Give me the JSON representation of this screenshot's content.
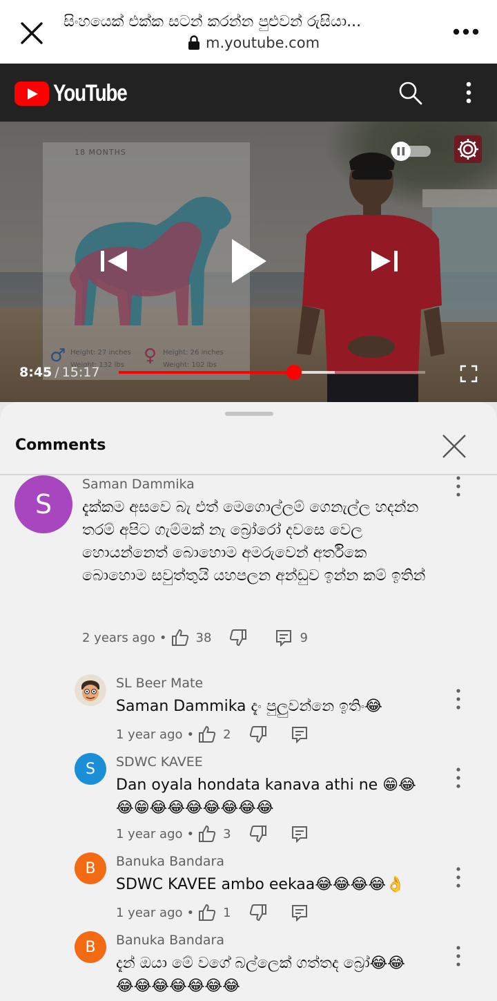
{
  "browser": {
    "title": "සිංහයෙක් එක්ක සටන් කරන්න පුළුවන් රුසියා...",
    "url": "m.youtube.com"
  },
  "header": {
    "logo_text": "YouTube"
  },
  "video": {
    "card_label": "18 MONTHS",
    "male_height": "Height: 27 inches",
    "male_weight": "Weight: 132 lbs",
    "female_height": "Height: 26 inches",
    "female_weight": "Weight: 102 lbs",
    "current_time": "8:45",
    "separator": "/",
    "duration": "15:17",
    "played_fraction": 0.572,
    "buffered_fraction": 0.705,
    "autoplay": "off"
  },
  "comments_panel": {
    "title": "Comments",
    "items": [
      {
        "author": "Saman Dammika",
        "avatar_letter": "S",
        "avatar_color": "#a846c0",
        "text": "දැක්කම අසවෙ බැ එත් මෙගොල්ලම් ගෙනැල්ල හදන්න තරම් අපිට ගැම්මක් නැ බ්‍රෝරෝ දවසෙ වෙල හොයන්නෙත් බොහොම අමරුවෙන් අර්තිකෙ බොහොම සවුත්තුයි යහපලන අන්ඩුව ඉන්න කම් ඉතින්",
        "age": "2 years ago",
        "likes": "38",
        "replies": "9"
      },
      {
        "author": "SL Beer Mate",
        "text": "Saman Dammika දැං පුලුවන්නෙ ඉතිං😂",
        "age": "1 year ago",
        "likes": "2"
      },
      {
        "author": "SDWC KAVEE",
        "avatar_letter": "S",
        "avatar_color": "#1a8fd8",
        "text": "Dan oyala hondata kanava athi ne 😁😂😂😁😂😂😂😂😂😂😂",
        "age": "1 year ago",
        "likes": "3"
      },
      {
        "author": "Banuka Bandara",
        "avatar_letter": "B",
        "avatar_color": "#f26a12",
        "text": "SDWC KAVEE ambo eekaa😂😂😂😂👌",
        "age": "1 year ago",
        "likes": "1"
      },
      {
        "author": "Banuka Bandara",
        "avatar_letter": "B",
        "avatar_color": "#f26a12",
        "text": "දැන් ඔයා මේ වගේ බල්ලෙක් ගත්තද බ්‍රෝ😂😂😂😂😂😂😂😂😂"
      }
    ]
  },
  "icons": [
    "close-icon",
    "lock-icon",
    "more-icon",
    "search-icon",
    "settings-icon",
    "previous-icon",
    "play-icon",
    "next-icon",
    "fullscreen-icon",
    "like-icon",
    "dislike-icon",
    "reply-icon"
  ],
  "colors": {
    "accent": "#ff0000",
    "header_bg": "#222222",
    "sheet_bg": "#f1f1f1"
  }
}
